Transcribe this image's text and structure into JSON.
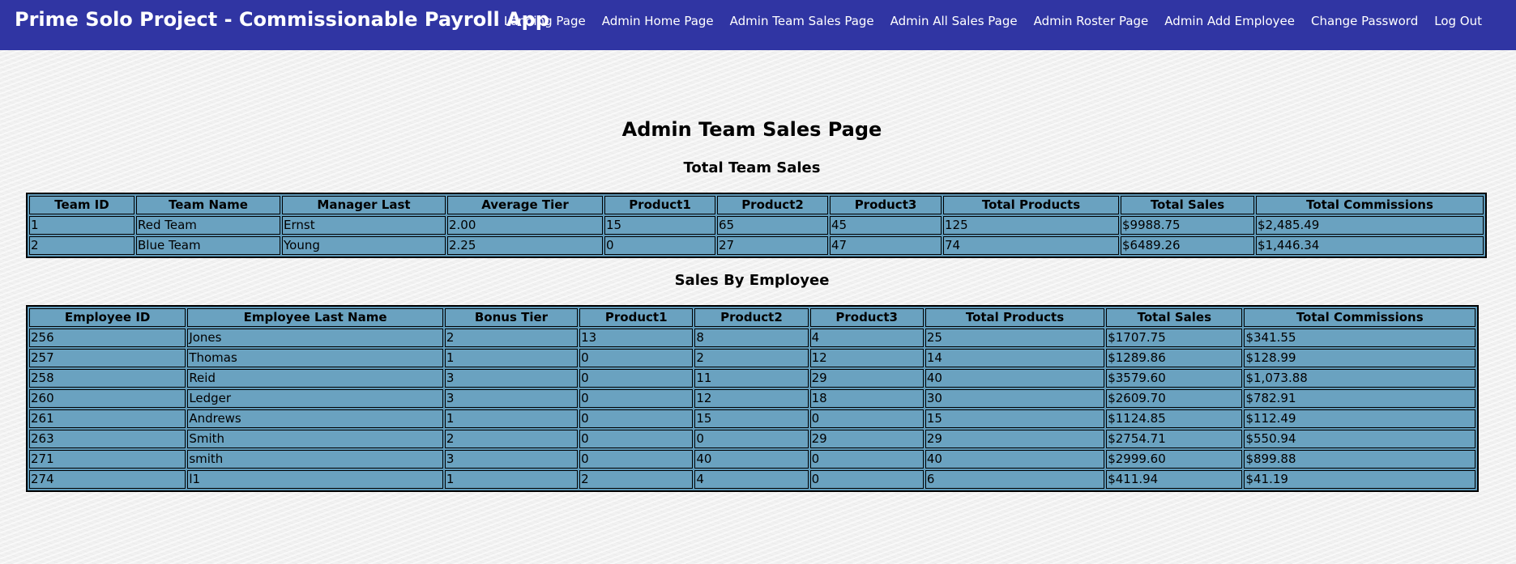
{
  "header": {
    "title": "Prime Solo Project - Commissionable Payroll App",
    "nav": [
      {
        "label": "Landing Page"
      },
      {
        "label": "Admin Home Page"
      },
      {
        "label": "Admin Team Sales Page"
      },
      {
        "label": "Admin All Sales Page"
      },
      {
        "label": "Admin Roster Page"
      },
      {
        "label": "Admin Add Employee"
      },
      {
        "label": "Change Password"
      },
      {
        "label": "Log Out"
      }
    ]
  },
  "main": {
    "page_title": "Admin Team Sales Page",
    "team_section_title": "Total Team Sales",
    "employee_section_title": "Sales By Employee",
    "team_table": {
      "columns": [
        "Team ID",
        "Team Name",
        "Manager Last",
        "Average Tier",
        "Product1",
        "Product2",
        "Product3",
        "Total Products",
        "Total Sales",
        "Total Commissions"
      ],
      "rows": [
        [
          "1",
          "Red Team",
          "Ernst",
          "2.00",
          "15",
          "65",
          "45",
          "125",
          "$9988.75",
          "$2,485.49"
        ],
        [
          "2",
          "Blue Team",
          "Young",
          "2.25",
          "0",
          "27",
          "47",
          "74",
          "$6489.26",
          "$1,446.34"
        ]
      ]
    },
    "employee_table": {
      "columns": [
        "Employee ID",
        "Employee Last Name",
        "Bonus Tier",
        "Product1",
        "Product2",
        "Product3",
        "Total Products",
        "Total Sales",
        "Total Commissions"
      ],
      "rows": [
        [
          "256",
          "Jones",
          "2",
          "13",
          "8",
          "4",
          "25",
          "$1707.75",
          "$341.55"
        ],
        [
          "257",
          "Thomas",
          "1",
          "0",
          "2",
          "12",
          "14",
          "$1289.86",
          "$128.99"
        ],
        [
          "258",
          "Reid",
          "3",
          "0",
          "11",
          "29",
          "40",
          "$3579.60",
          "$1,073.88"
        ],
        [
          "260",
          "Ledger",
          "3",
          "0",
          "12",
          "18",
          "30",
          "$2609.70",
          "$782.91"
        ],
        [
          "261",
          "Andrews",
          "1",
          "0",
          "15",
          "0",
          "15",
          "$1124.85",
          "$112.49"
        ],
        [
          "263",
          "Smith",
          "2",
          "0",
          "0",
          "29",
          "29",
          "$2754.71",
          "$550.94"
        ],
        [
          "271",
          "smith",
          "3",
          "0",
          "40",
          "0",
          "40",
          "$2999.60",
          "$899.88"
        ],
        [
          "274",
          "l1",
          "1",
          "2",
          "4",
          "0",
          "6",
          "$411.94",
          "$41.19"
        ]
      ]
    }
  },
  "colors": {
    "navbar": "#3035a3",
    "table_cell": "#6aa2c0"
  }
}
